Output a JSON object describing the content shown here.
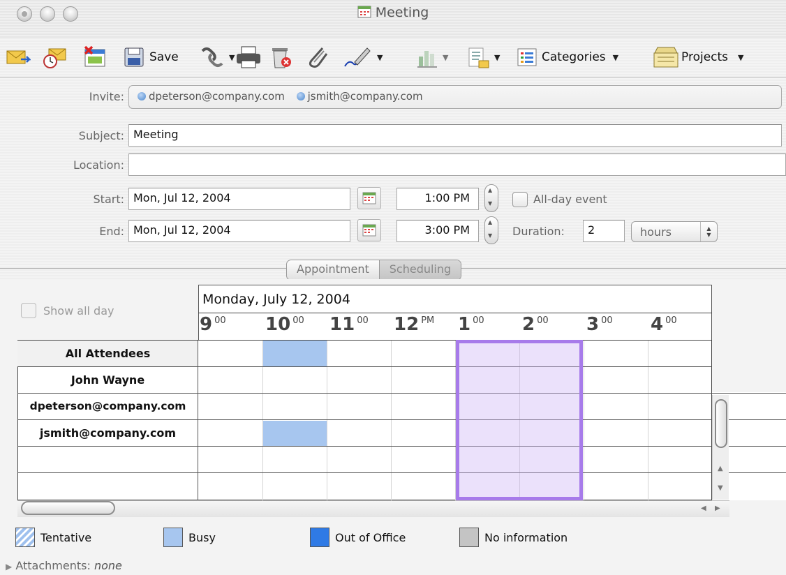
{
  "window": {
    "title": "Meeting"
  },
  "toolbar": {
    "save_label": "Save",
    "categories_label": "Categories",
    "projects_label": "Projects"
  },
  "form": {
    "invite_label": "Invite:",
    "invitees": [
      "dpeterson@company.com",
      "jsmith@company.com"
    ],
    "subject_label": "Subject:",
    "subject_value": "Meeting",
    "location_label": "Location:",
    "location_value": "",
    "start_label": "Start:",
    "start_date": "Mon, Jul 12, 2004",
    "start_time": "1:00 PM",
    "all_day_label": "All-day event",
    "end_label": "End:",
    "end_date": "Mon, Jul 12, 2004",
    "end_time": "3:00 PM",
    "duration_label": "Duration:",
    "duration_value": "2",
    "duration_unit": "hours"
  },
  "tabs": {
    "appointment": "Appointment",
    "scheduling": "Scheduling"
  },
  "scheduling": {
    "show_all_day_label": "Show all day",
    "day_title": "Monday, July 12, 2004",
    "hours": [
      {
        "h": "9",
        "s": "00"
      },
      {
        "h": "10",
        "s": "00"
      },
      {
        "h": "11",
        "s": "00"
      },
      {
        "h": "12",
        "s": "PM"
      },
      {
        "h": "1",
        "s": "00"
      },
      {
        "h": "2",
        "s": "00"
      },
      {
        "h": "3",
        "s": "00"
      },
      {
        "h": "4",
        "s": "00"
      }
    ],
    "attendees": [
      "All Attendees",
      "John Wayne",
      "dpeterson@company.com",
      "jsmith@company.com",
      "",
      ""
    ]
  },
  "legend": {
    "tentative": "Tentative",
    "busy": "Busy",
    "out_of_office": "Out of Office",
    "no_information": "No information",
    "colors": {
      "tentative": "#9ec0ee",
      "busy": "#a7c6ef",
      "out_of_office": "#2f7ae5",
      "no_information": "#c4c4c4",
      "meeting_outline": "#a77bea"
    }
  },
  "attachments": {
    "label": "Attachments:",
    "value": "none"
  }
}
